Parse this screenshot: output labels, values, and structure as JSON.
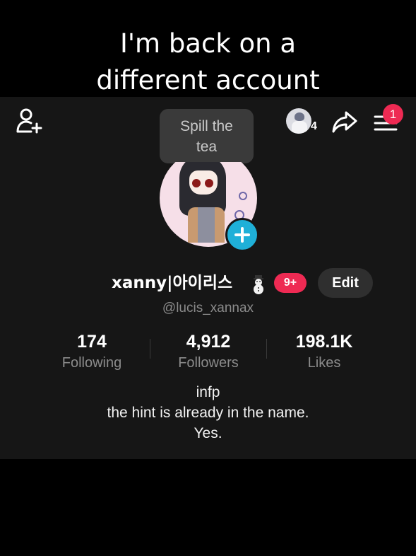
{
  "caption": {
    "line1": "I'm back on a",
    "line2": "different account"
  },
  "header": {
    "tooltip_line1": "Spill the",
    "tooltip_line2": "tea",
    "story_count": "4",
    "menu_badge": "1"
  },
  "profile": {
    "name": "xanny|아이리스",
    "badge": "9+",
    "edit_label": "Edit",
    "handle": "@lucis_xannax"
  },
  "stats": [
    {
      "value": "174",
      "label": "Following"
    },
    {
      "value": "4,912",
      "label": "Followers"
    },
    {
      "value": "198.1K",
      "label": "Likes"
    }
  ],
  "bio": {
    "line1": "infp",
    "line2": "the hint is already in the name.",
    "line3": "Yes."
  },
  "colors": {
    "accent_red": "#ee2a53",
    "accent_blue": "#1fb0d8",
    "panel_bg": "#161616"
  }
}
